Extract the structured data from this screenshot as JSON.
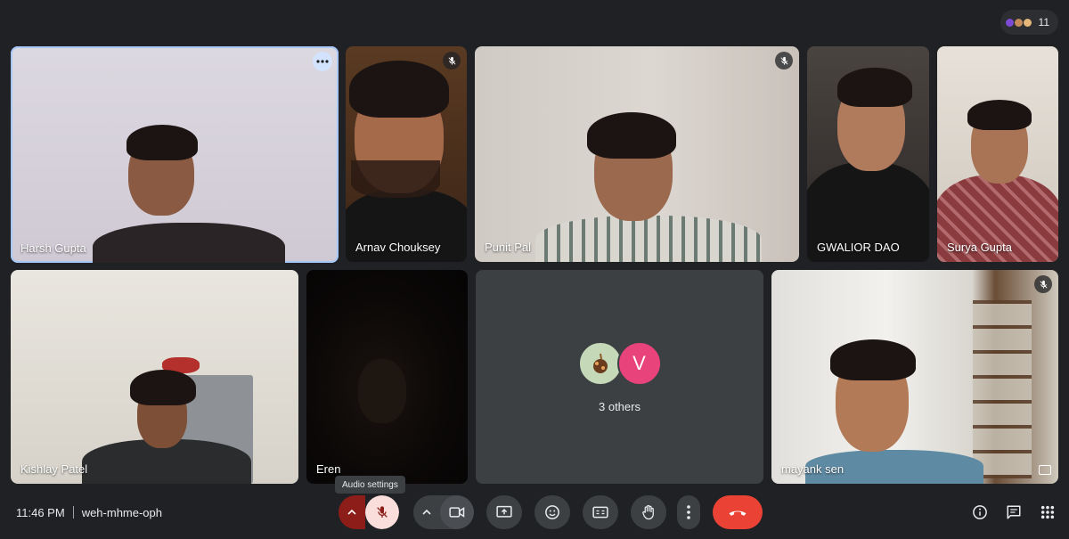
{
  "participants_count": "11",
  "tiles": [
    {
      "name": "Harsh Gupta"
    },
    {
      "name": "Arnav Chouksey"
    },
    {
      "name": "Punit Pal"
    },
    {
      "name": "GWALIOR DAO"
    },
    {
      "name": "Surya Gupta"
    },
    {
      "name": "Kishlay Patel"
    },
    {
      "name": "Eren"
    },
    {
      "name": "mayank sen"
    }
  ],
  "others": {
    "avatar_letter": "V",
    "label": "3 others"
  },
  "tooltip": "Audio settings",
  "meeting": {
    "time": "11:46 PM",
    "code": "weh-mhme-oph"
  },
  "colors": {
    "background": "#202124",
    "tile": "#3c4043",
    "leave": "#ea4335",
    "mic_muted": "#f9dedc",
    "mic_caret": "#8c1d18",
    "active_outline": "#a8c7fa",
    "avatar_v": "#e8437a"
  }
}
